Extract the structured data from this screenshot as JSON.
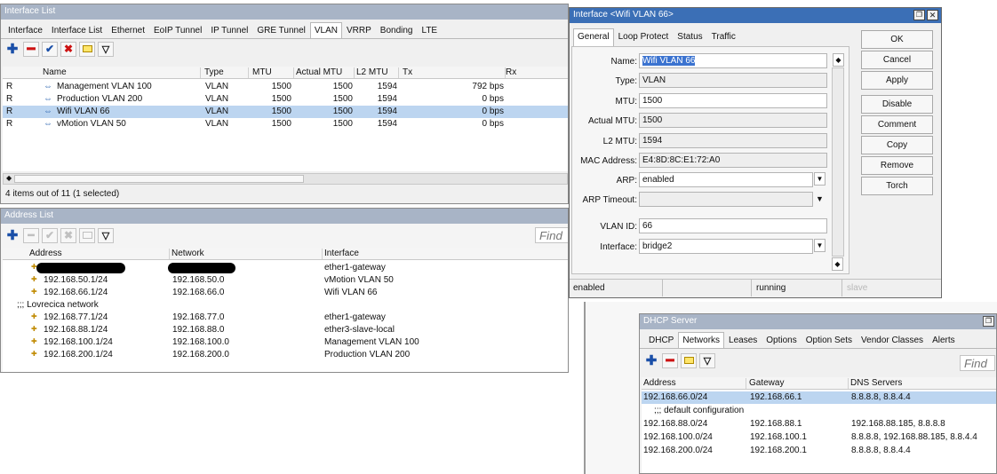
{
  "interface_list": {
    "title": "Interface List",
    "tabs": [
      "Interface",
      "Interface List",
      "Ethernet",
      "EoIP Tunnel",
      "IP Tunnel",
      "GRE Tunnel",
      "VLAN",
      "VRRP",
      "Bonding",
      "LTE"
    ],
    "selected_tab": "VLAN",
    "columns": [
      "Name",
      "Type",
      "MTU",
      "Actual MTU",
      "L2 MTU",
      "Tx",
      "Rx"
    ],
    "rows": [
      {
        "flag": "R",
        "name": "Management VLAN 100",
        "type": "VLAN",
        "mtu": "1500",
        "actual_mtu": "1500",
        "l2_mtu": "1594",
        "tx": "792 bps"
      },
      {
        "flag": "R",
        "name": "Production VLAN 200",
        "type": "VLAN",
        "mtu": "1500",
        "actual_mtu": "1500",
        "l2_mtu": "1594",
        "tx": "0 bps"
      },
      {
        "flag": "R",
        "name": "Wifi VLAN 66",
        "type": "VLAN",
        "mtu": "1500",
        "actual_mtu": "1500",
        "l2_mtu": "1594",
        "tx": "0 bps"
      },
      {
        "flag": "R",
        "name": "vMotion VLAN 50",
        "type": "VLAN",
        "mtu": "1500",
        "actual_mtu": "1500",
        "l2_mtu": "1594",
        "tx": "0 bps"
      }
    ],
    "status": "4 items out of 11 (1 selected)"
  },
  "address_list": {
    "title": "Address List",
    "find_placeholder": "Find",
    "columns": [
      "Address",
      "Network",
      "Interface"
    ],
    "rows": [
      {
        "address": "",
        "network": "",
        "interface": "ether1-gateway",
        "redacted": true
      },
      {
        "address": "192.168.50.1/24",
        "network": "192.168.50.0",
        "interface": "vMotion VLAN 50"
      },
      {
        "address": "192.168.66.1/24",
        "network": "192.168.66.0",
        "interface": "Wifi VLAN 66"
      },
      {
        "comment": ";;; Lovrecica network"
      },
      {
        "address": "192.168.77.1/24",
        "network": "192.168.77.0",
        "interface": "ether1-gateway"
      },
      {
        "address": "192.168.88.1/24",
        "network": "192.168.88.0",
        "interface": "ether3-slave-local"
      },
      {
        "address": "192.168.100.1/24",
        "network": "192.168.100.0",
        "interface": "Management VLAN 100"
      },
      {
        "address": "192.168.200.1/24",
        "network": "192.168.200.0",
        "interface": "Production VLAN 200"
      }
    ]
  },
  "vlan_dialog": {
    "title": "Interface <Wifi VLAN 66>",
    "tabs": [
      "General",
      "Loop Protect",
      "Status",
      "Traffic"
    ],
    "fields": {
      "name_label": "Name:",
      "name": "Wifi VLAN 66",
      "type_label": "Type:",
      "type": "VLAN",
      "mtu_label": "MTU:",
      "mtu": "1500",
      "actual_mtu_label": "Actual MTU:",
      "actual_mtu": "1500",
      "l2_mtu_label": "L2 MTU:",
      "l2_mtu": "1594",
      "mac_label": "MAC Address:",
      "mac": "E4:8D:8C:E1:72:A0",
      "arp_label": "ARP:",
      "arp": "enabled",
      "arp_timeout_label": "ARP Timeout:",
      "arp_timeout": "",
      "vlan_id_label": "VLAN ID:",
      "vlan_id": "66",
      "interface_label": "Interface:",
      "interface": "bridge2"
    },
    "buttons": [
      "OK",
      "Cancel",
      "Apply",
      "Disable",
      "Comment",
      "Copy",
      "Remove",
      "Torch"
    ],
    "status": {
      "state": "enabled",
      "running": "running",
      "slave": "slave"
    }
  },
  "dhcp_server": {
    "title": "DHCP Server",
    "tabs": [
      "DHCP",
      "Networks",
      "Leases",
      "Options",
      "Option Sets",
      "Vendor Classes",
      "Alerts"
    ],
    "selected_tab": "Networks",
    "find_placeholder": "Find",
    "columns": [
      "Address",
      "Gateway",
      "DNS Servers"
    ],
    "rows": [
      {
        "address": "192.168.66.0/24",
        "gateway": "192.168.66.1",
        "dns": "8.8.8.8, 8.8.4.4"
      },
      {
        "comment": ";;; default configuration"
      },
      {
        "address": "192.168.88.0/24",
        "gateway": "192.168.88.1",
        "dns": "192.168.88.185, 8.8.8.8"
      },
      {
        "address": "192.168.100.0/24",
        "gateway": "192.168.100.1",
        "dns": "8.8.8.8, 192.168.88.185, 8.8.4.4"
      },
      {
        "address": "192.168.200.0/24",
        "gateway": "192.168.200.1",
        "dns": "8.8.8.8, 8.8.4.4"
      }
    ]
  },
  "colors": {
    "title_active": "#3b6fb6",
    "title_inactive": "#a8b4c6",
    "selection": "#bcd5f0",
    "add_icon": "#1a4fa8",
    "remove_icon": "#cc1111",
    "check_icon": "#1a4fa8"
  }
}
